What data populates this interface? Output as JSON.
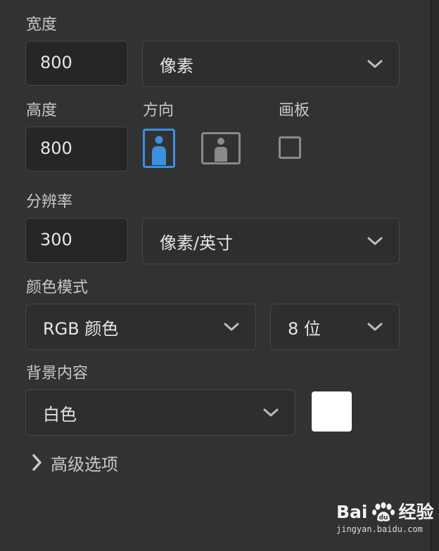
{
  "width": {
    "label": "宽度",
    "value": "800",
    "unit": "像素"
  },
  "height": {
    "label": "高度",
    "value": "800"
  },
  "orientation": {
    "label": "方向",
    "options": [
      "portrait",
      "landscape"
    ],
    "selected": "portrait"
  },
  "artboard": {
    "label": "画板",
    "checked": false
  },
  "resolution": {
    "label": "分辨率",
    "value": "300",
    "unit": "像素/英寸"
  },
  "color_mode": {
    "label": "颜色模式",
    "mode": "RGB 颜色",
    "depth": "8 位"
  },
  "background": {
    "label": "背景内容",
    "value": "白色",
    "swatch_color": "#ffffff"
  },
  "advanced": {
    "label": "高级选项"
  },
  "colors": {
    "accent": "#3d8fe0",
    "panel_bg": "#323232",
    "field_bg": "#262626"
  },
  "watermark": {
    "brand_latin": "Bai",
    "brand_cn": "经验",
    "url": "jingyan.baidu.com"
  }
}
